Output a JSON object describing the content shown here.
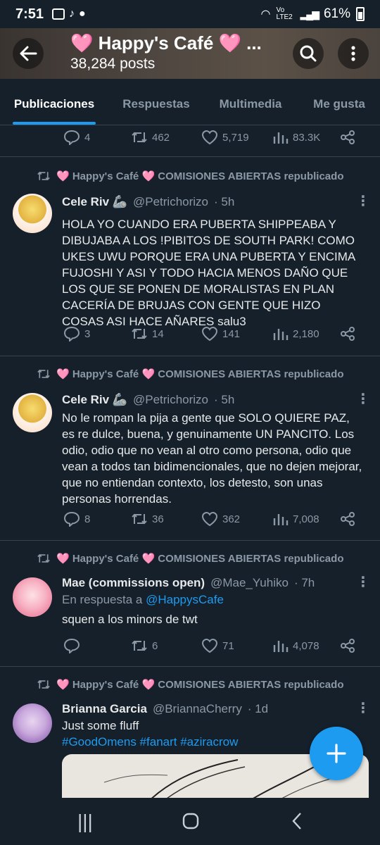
{
  "status_bar": {
    "time": "7:51",
    "signal": "Vo LTE2",
    "battery": "61%"
  },
  "header": {
    "title": "🩷 Happy's Café 🩷 ...",
    "posts_count": "38,284 posts",
    "accent": "#1d9bf0"
  },
  "tabs": [
    {
      "label": "Publicaciones",
      "active": true
    },
    {
      "label": "Respuestas",
      "active": false
    },
    {
      "label": "Multimedia",
      "active": false
    },
    {
      "label": "Me gusta",
      "active": false
    }
  ],
  "top_actions": {
    "replies": "4",
    "reposts": "462",
    "likes": "5,719",
    "views": "83.3K"
  },
  "reposted_by": "🩷 Happy's Café 🩷 COMISIONES ABIERTAS republicado",
  "posts": [
    {
      "name": "Cele Riv 🦾",
      "handle": "@Petrichorizo",
      "time": "· 5h",
      "text": "HOLA YO CUANDO ERA PUBERTA SHIPPEABA Y DIBUJABA A LOS !PIBITOS DE SOUTH PARK! COMO UKES UWU PORQUE ERA UNA PUBERTA Y ENCIMA FUJOSHI Y ASI Y TODO HACIA MENOS DAÑO QUE LOS QUE SE PONEN DE MORALISTAS EN PLAN CACERÍA DE BRUJAS CON GENTE QUE HIZO COSAS ASI HACE AÑARES salu3",
      "replies": "3",
      "reposts": "14",
      "likes": "141",
      "views": "2,180"
    },
    {
      "name": "Cele Riv 🦾",
      "handle": "@Petrichorizo",
      "time": "· 5h",
      "text": "No le rompan la pija a gente que SOLO QUIERE PAZ, es re dulce, buena, y genuinamente UN PANCITO. Los odio, odio que no vean al otro como persona, odio que vean a todos tan bidimencionales, que no dejen mejorar, que no entiendan contexto, los detesto, son unas personas horrendas.",
      "replies": "8",
      "reposts": "36",
      "likes": "362",
      "views": "7,008"
    },
    {
      "name": "Mae (commissions open)",
      "handle": "@Mae_Yuhiko",
      "time": "· 7h",
      "reply_prefix": "En respuesta a",
      "reply_mention": "@HappysCafe",
      "text": "squen a los minors de twt",
      "replies": "",
      "reposts": "6",
      "likes": "71",
      "views": "4,078"
    },
    {
      "name": "Brianna Garcia",
      "handle": "@BriannaCherry",
      "time": "· 1d",
      "text": "Just some fluff",
      "tags": "#GoodOmens #fanart #aziracrow"
    }
  ],
  "icons": {
    "back": "arrow-left-icon",
    "search": "search-icon",
    "more": "more-vertical-icon",
    "reply": "reply-icon",
    "repost": "repost-icon",
    "like": "heart-icon",
    "views": "views-icon",
    "share": "share-icon",
    "fab": "plus-icon",
    "nav_recents": "recents-icon",
    "nav_home": "home-icon",
    "nav_back": "back-icon"
  },
  "nav": {
    "recents": "|||",
    "home": "○",
    "back": "<"
  }
}
